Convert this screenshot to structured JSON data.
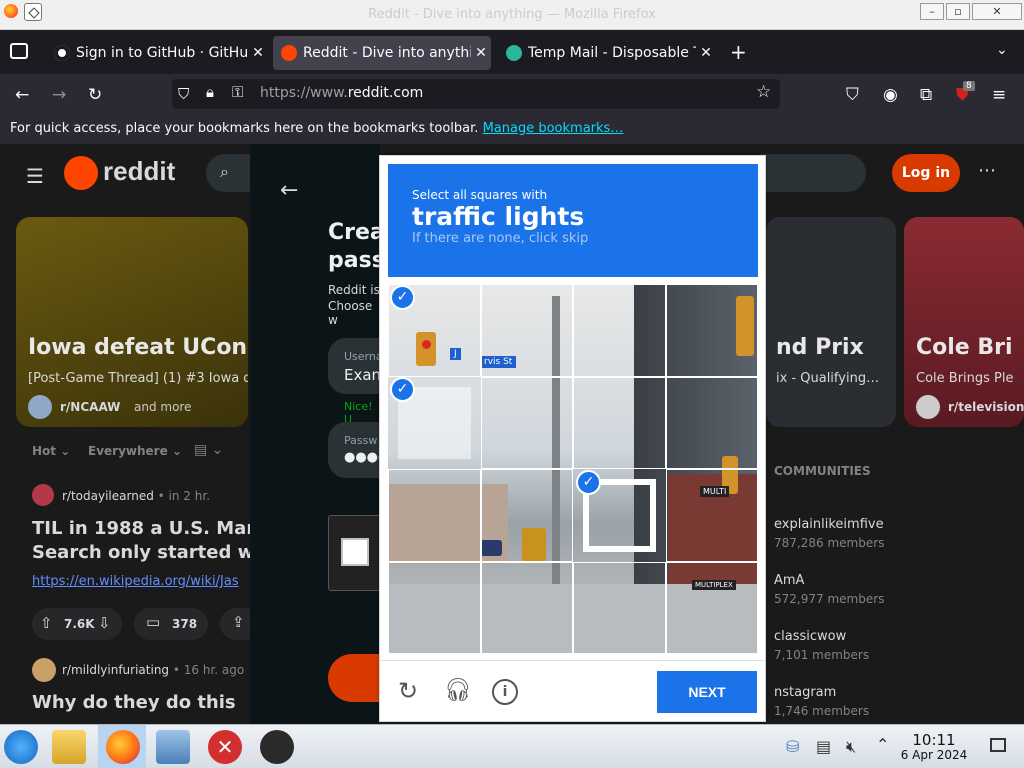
{
  "window": {
    "title": "Reddit - Dive into anything — Mozilla Firefox"
  },
  "tabs": [
    {
      "label": "Sign in to GitHub · GitHub",
      "active": false
    },
    {
      "label": "Reddit - Dive into anything",
      "active": true
    },
    {
      "label": "Temp Mail - Disposable Temporary Email",
      "active": false
    }
  ],
  "nav": {
    "url_prefix": "https://www.",
    "url_domain": "reddit.com",
    "extension_badge": "8"
  },
  "bookmarks_bar": {
    "text": "For quick access, place your bookmarks here on the bookmarks toolbar.",
    "link": "Manage bookmarks…"
  },
  "reddit": {
    "logo": "reddit",
    "login": "Log in",
    "featured": [
      {
        "title": "Iowa defeat UConn",
        "subtitle": "[Post-Game Thread] (1) #3 Iowa de",
        "community": "r/NCAAW",
        "extra": "and more"
      },
      {
        "title": "nd Prix",
        "subtitle": "ix - Qualifying…"
      },
      {
        "title": "Cole Bri",
        "subtitle": "Cole Brings Ple",
        "community": "r/television"
      }
    ],
    "sort": {
      "hot": "Hot",
      "everywhere": "Everywhere"
    },
    "post1": {
      "community": "r/todayilearned",
      "time": "• in 2 hr.",
      "title1": "TIL in 1988 a U.S. Marine",
      "title2": "Search only started when",
      "link": "https://en.wikipedia.org/wiki/Jas",
      "votes": "7.6K",
      "comments": "378"
    },
    "post2": {
      "community": "r/mildlyinfuriating",
      "time": "• 16 hr. ago",
      "title": "Why do they do this"
    },
    "communities": {
      "header": "COMMUNITIES",
      "items": [
        {
          "name": "explainlikeimfive",
          "members": "787,286 members"
        },
        {
          "name": "AmA",
          "members": "572,977 members"
        },
        {
          "name": "classicwow",
          "members": "7,101 members"
        },
        {
          "name": "nstagram",
          "members": "1,746 members"
        }
      ]
    }
  },
  "signup": {
    "title1": "Crea",
    "title2": "pass",
    "desc1": "Reddit is",
    "desc2": "Choose w",
    "username_label": "Userna",
    "username_value": "Exan",
    "nice": "Nice! U",
    "password_label": "Passw",
    "password_value": "●●●●"
  },
  "captcha": {
    "instruction": "Select all squares with",
    "target": "traffic lights",
    "hint": "If there are none, click skip",
    "next": "NEXT",
    "signs": {
      "sign1": "J",
      "sign2": "rvis St"
    },
    "store": "MULTI",
    "store2": "MULTIPLEX"
  },
  "taskbar": {
    "time": "10:11",
    "date": "6 Apr 2024"
  },
  "colors": {
    "captcha_blue": "#1a73e8",
    "reddit_orange": "#d93a00",
    "bg": "#1a1a1b"
  }
}
